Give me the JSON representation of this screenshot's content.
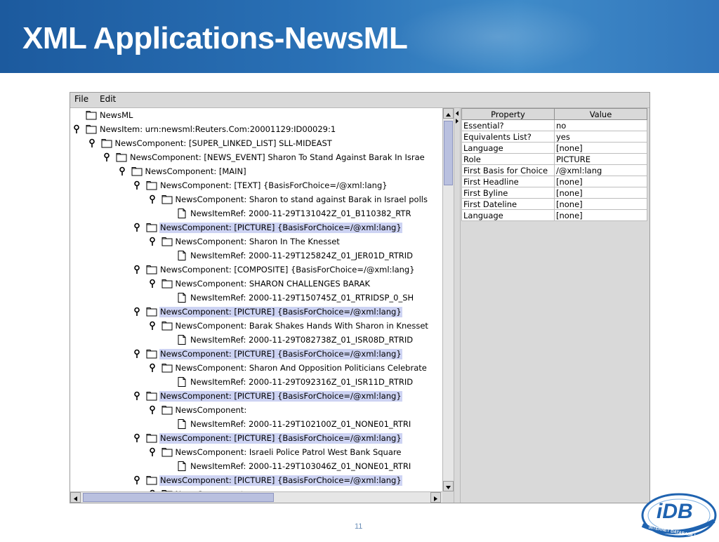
{
  "slide": {
    "title": "XML Applications-NewsML",
    "page_number": "11"
  },
  "menu": [
    "File",
    "Edit"
  ],
  "tree": {
    "rows": [
      {
        "label": "NewsML",
        "depth": 0,
        "icon": "folder",
        "handle": false,
        "selected": false
      },
      {
        "label": "NewsItem: urn:newsml:Reuters.Com:20001129:ID00029:1",
        "depth": 0,
        "icon": "folder",
        "handle": true,
        "selected": false
      },
      {
        "label": "NewsComponent: [SUPER_LINKED_LIST] SLL-MIDEAST",
        "depth": 1,
        "icon": "folder",
        "handle": true,
        "selected": false
      },
      {
        "label": "NewsComponent: [NEWS_EVENT] Sharon To Stand Against Barak In Israe",
        "depth": 2,
        "icon": "folder",
        "handle": true,
        "selected": false
      },
      {
        "label": "NewsComponent: [MAIN]",
        "depth": 3,
        "icon": "folder",
        "handle": true,
        "selected": false
      },
      {
        "label": "NewsComponent: [TEXT] {BasisForChoice=/@xml:lang}",
        "depth": 4,
        "icon": "folder",
        "handle": true,
        "selected": false
      },
      {
        "label": "NewsComponent: Sharon to stand against Barak in Israel polls",
        "depth": 5,
        "icon": "folder",
        "handle": true,
        "selected": false
      },
      {
        "label": "NewsItemRef: 2000-11-29T131042Z_01_B110382_RTR",
        "depth": 6,
        "icon": "file",
        "handle": false,
        "selected": false
      },
      {
        "label": "NewsComponent: [PICTURE] {BasisForChoice=/@xml:lang}",
        "depth": 4,
        "icon": "folder",
        "handle": true,
        "selected": true
      },
      {
        "label": "NewsComponent: Sharon In The Knesset",
        "depth": 5,
        "icon": "folder",
        "handle": true,
        "selected": false
      },
      {
        "label": "NewsItemRef: 2000-11-29T125824Z_01_JER01D_RTRID",
        "depth": 6,
        "icon": "file",
        "handle": false,
        "selected": false
      },
      {
        "label": "NewsComponent: [COMPOSITE] {BasisForChoice=/@xml:lang}",
        "depth": 4,
        "icon": "folder",
        "handle": true,
        "selected": false
      },
      {
        "label": "NewsComponent: SHARON CHALLENGES BARAK",
        "depth": 5,
        "icon": "folder",
        "handle": true,
        "selected": false
      },
      {
        "label": "NewsItemRef: 2000-11-29T150745Z_01_RTRIDSP_0_SH",
        "depth": 6,
        "icon": "file",
        "handle": false,
        "selected": false
      },
      {
        "label": "NewsComponent: [PICTURE] {BasisForChoice=/@xml:lang}",
        "depth": 4,
        "icon": "folder",
        "handle": true,
        "selected": true
      },
      {
        "label": "NewsComponent: Barak Shakes Hands With Sharon in Knesset",
        "depth": 5,
        "icon": "folder",
        "handle": true,
        "selected": false
      },
      {
        "label": "NewsItemRef: 2000-11-29T082738Z_01_ISR08D_RTRID",
        "depth": 6,
        "icon": "file",
        "handle": false,
        "selected": false
      },
      {
        "label": "NewsComponent: [PICTURE] {BasisForChoice=/@xml:lang}",
        "depth": 4,
        "icon": "folder",
        "handle": true,
        "selected": true
      },
      {
        "label": "NewsComponent: Sharon And Opposition Politicians Celebrate",
        "depth": 5,
        "icon": "folder",
        "handle": true,
        "selected": false
      },
      {
        "label": "NewsItemRef: 2000-11-29T092316Z_01_ISR11D_RTRID",
        "depth": 6,
        "icon": "file",
        "handle": false,
        "selected": false
      },
      {
        "label": "NewsComponent: [PICTURE] {BasisForChoice=/@xml:lang}",
        "depth": 4,
        "icon": "folder",
        "handle": true,
        "selected": true
      },
      {
        "label": "NewsComponent:",
        "depth": 5,
        "icon": "folder",
        "handle": true,
        "selected": false
      },
      {
        "label": "NewsItemRef: 2000-11-29T102100Z_01_NONE01_RTRI",
        "depth": 6,
        "icon": "file",
        "handle": false,
        "selected": false
      },
      {
        "label": "NewsComponent: [PICTURE] {BasisForChoice=/@xml:lang}",
        "depth": 4,
        "icon": "folder",
        "handle": true,
        "selected": true
      },
      {
        "label": "NewsComponent: Israeli Police Patrol West Bank Square",
        "depth": 5,
        "icon": "folder",
        "handle": true,
        "selected": false
      },
      {
        "label": "NewsItemRef: 2000-11-29T103046Z_01_NONE01_RTRI",
        "depth": 6,
        "icon": "file",
        "handle": false,
        "selected": false
      },
      {
        "label": "NewsComponent: [PICTURE] {BasisForChoice=/@xml:lang}",
        "depth": 4,
        "icon": "folder",
        "handle": true,
        "selected": true
      },
      {
        "label": "NewsComponent:",
        "depth": 5,
        "icon": "folder",
        "handle": true,
        "selected": false
      }
    ]
  },
  "properties": {
    "headers": [
      "Property",
      "Value"
    ],
    "rows": [
      [
        "Essential?",
        "no"
      ],
      [
        "Equivalents List?",
        "yes"
      ],
      [
        "Language",
        "[none]"
      ],
      [
        "Role",
        "PICTURE"
      ],
      [
        "First Basis for Choice",
        "/@xml:lang"
      ],
      [
        "First Headline",
        "[none]"
      ],
      [
        "First Byline",
        "[none]"
      ],
      [
        "First Dateline",
        "[none]"
      ],
      [
        "Language",
        "[none]"
      ]
    ]
  },
  "logo": {
    "text": "iDB",
    "ring_text": "INTERNET DATABASE LAB"
  },
  "colors": {
    "header_blue": "#2a71b6",
    "selection": "#cdd3f3",
    "logo_blue": "#1f63b0"
  }
}
